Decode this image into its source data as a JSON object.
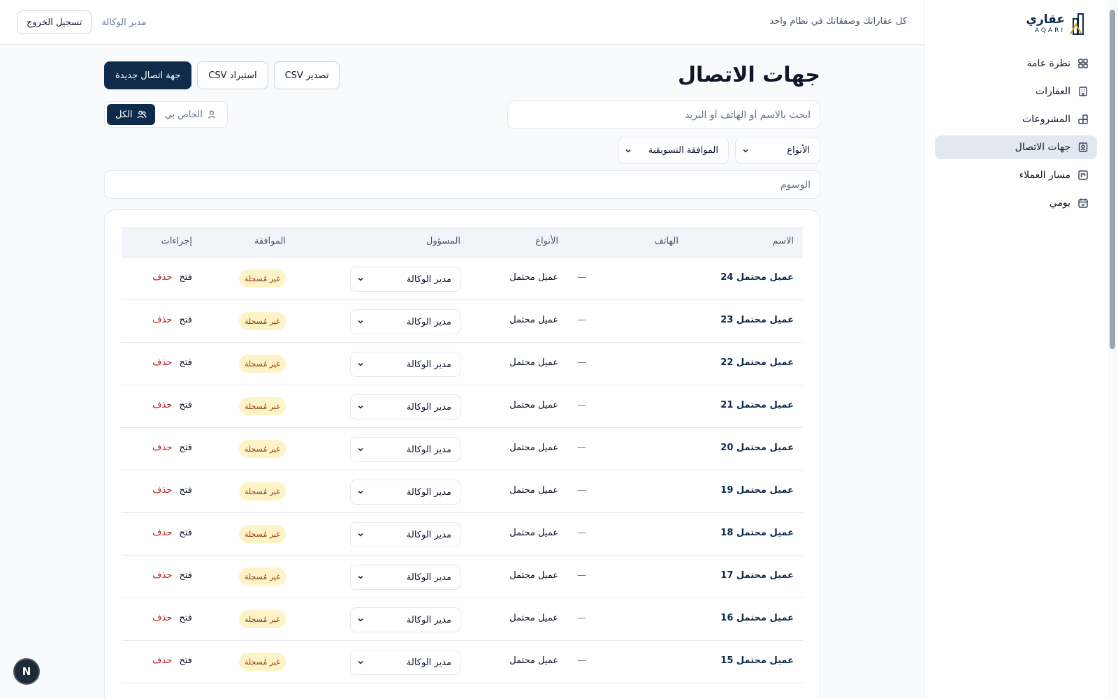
{
  "brand": {
    "name_ar": "عقاري",
    "name_en": "AQARI"
  },
  "sidebar": {
    "items": [
      {
        "label": "نظرة عامة",
        "icon": "dashboard-grid-icon",
        "active": false
      },
      {
        "label": "العقارات",
        "icon": "building-icon",
        "active": false
      },
      {
        "label": "المشروعات",
        "icon": "blocks-icon",
        "active": false
      },
      {
        "label": "جهات الاتصال",
        "icon": "contact-card-icon",
        "active": true
      },
      {
        "label": "مسار العملاء",
        "icon": "kanban-icon",
        "active": false
      },
      {
        "label": "يومي",
        "icon": "calendar-check-icon",
        "active": false
      }
    ]
  },
  "header": {
    "tagline": "كل عقاراتك وصفقاتك في نظام واحد",
    "user": "مدير الوكالة",
    "logout": "تسجيل الخروج"
  },
  "page": {
    "title": "جهات الاتصال",
    "export": "تصدير CSV",
    "import": "استيراد CSV",
    "new": "جهة اتصال جديدة",
    "search_placeholder": "ابحث بالاسم أو الهاتف أو البريد",
    "scope_mine": "الخاص بي",
    "scope_all": "الكل",
    "filter_types": "الأنواع",
    "filter_consent": "الموافقة التسويقية",
    "tags_placeholder": "الوسوم"
  },
  "table": {
    "headers": {
      "name": "الاسم",
      "phone": "الهاتف",
      "types": "الأنواع",
      "owner": "المسؤول",
      "consent": "الموافقة",
      "actions": "إجراءات"
    },
    "rows": [
      {
        "name": "عميل محتمل 24",
        "phone": "—",
        "types": "عميل محتمل",
        "owner": "مدير الوكالة",
        "consent": "غير مُسجلة",
        "open": "فتح",
        "delete": "حذف"
      },
      {
        "name": "عميل محتمل 23",
        "phone": "—",
        "types": "عميل محتمل",
        "owner": "مدير الوكالة",
        "consent": "غير مُسجلة",
        "open": "فتح",
        "delete": "حذف"
      },
      {
        "name": "عميل محتمل 22",
        "phone": "—",
        "types": "عميل محتمل",
        "owner": "مدير الوكالة",
        "consent": "غير مُسجلة",
        "open": "فتح",
        "delete": "حذف"
      },
      {
        "name": "عميل محتمل 21",
        "phone": "—",
        "types": "عميل محتمل",
        "owner": "مدير الوكالة",
        "consent": "غير مُسجلة",
        "open": "فتح",
        "delete": "حذف"
      },
      {
        "name": "عميل محتمل 20",
        "phone": "—",
        "types": "عميل محتمل",
        "owner": "مدير الوكالة",
        "consent": "غير مُسجلة",
        "open": "فتح",
        "delete": "حذف"
      },
      {
        "name": "عميل محتمل 19",
        "phone": "—",
        "types": "عميل محتمل",
        "owner": "مدير الوكالة",
        "consent": "غير مُسجلة",
        "open": "فتح",
        "delete": "حذف"
      },
      {
        "name": "عميل محتمل 18",
        "phone": "—",
        "types": "عميل محتمل",
        "owner": "مدير الوكالة",
        "consent": "غير مُسجلة",
        "open": "فتح",
        "delete": "حذف"
      },
      {
        "name": "عميل محتمل 17",
        "phone": "—",
        "types": "عميل محتمل",
        "owner": "مدير الوكالة",
        "consent": "غير مُسجلة",
        "open": "فتح",
        "delete": "حذف"
      },
      {
        "name": "عميل محتمل 16",
        "phone": "—",
        "types": "عميل محتمل",
        "owner": "مدير الوكالة",
        "consent": "غير مُسجلة",
        "open": "فتح",
        "delete": "حذف"
      },
      {
        "name": "عميل محتمل 15",
        "phone": "—",
        "types": "عميل محتمل",
        "owner": "مدير الوكالة",
        "consent": "غير مُسجلة",
        "open": "فتح",
        "delete": "حذف"
      }
    ]
  },
  "dev_badge": "N",
  "colors": {
    "primary": "#0f2a4a",
    "badge_bg": "#fef3c7",
    "badge_text": "#92400e",
    "danger": "#b91c1c",
    "active_nav": "#e2e8f0"
  }
}
